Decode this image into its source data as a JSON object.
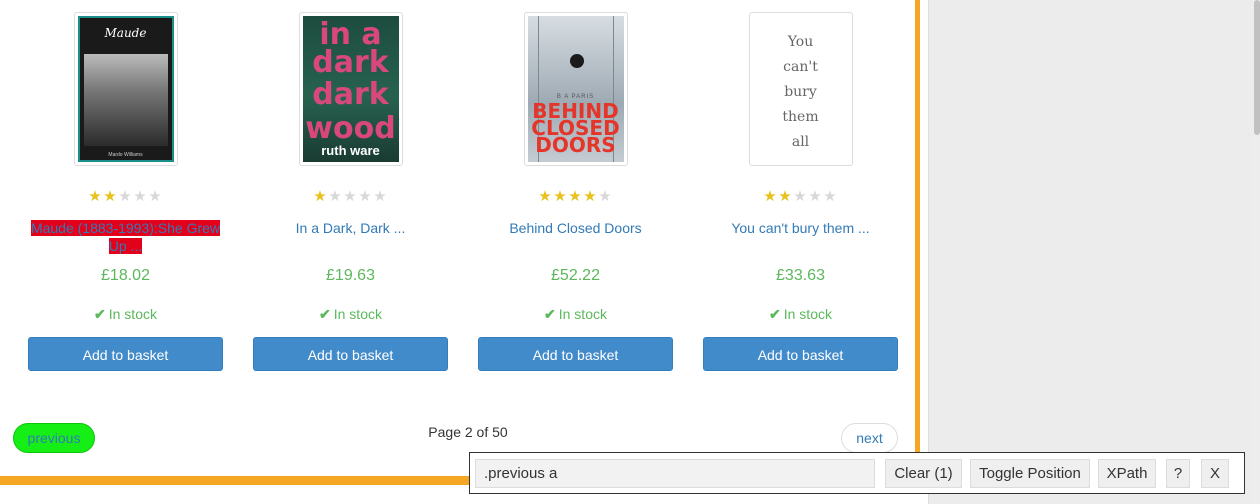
{
  "products": [
    {
      "title": "Maude (1883-1993):She Grew Up ...",
      "price": "£18.02",
      "stock": "In stock",
      "rating": 2,
      "button": "Add to basket",
      "highlighted": true,
      "cover": {
        "title": "Maude",
        "author": "Mardo Williams"
      }
    },
    {
      "title": "In a Dark, Dark ...",
      "price": "£19.63",
      "stock": "In stock",
      "rating": 1,
      "button": "Add to basket",
      "highlighted": false,
      "cover": {
        "lines": [
          "in a",
          "dark",
          "dark",
          "wood"
        ],
        "author": "ruth ware"
      }
    },
    {
      "title": "Behind Closed Doors",
      "price": "£52.22",
      "stock": "In stock",
      "rating": 4,
      "button": "Add to basket",
      "highlighted": false,
      "cover": {
        "author": "B A PARIS",
        "lines": [
          "BEHIND",
          "CLOSED",
          "DOORS"
        ]
      }
    },
    {
      "title": "You can't bury them ...",
      "price": "£33.63",
      "stock": "In stock",
      "rating": 2,
      "button": "Add to basket",
      "highlighted": false,
      "cover": {
        "lines": [
          "You",
          "can't",
          "bury",
          "them",
          "all"
        ]
      }
    }
  ],
  "pager": {
    "previous": "previous",
    "current": "Page 2 of 50",
    "next": "next"
  },
  "toolbar": {
    "selector_value": ".previous a",
    "clear": "Clear (1)",
    "toggle": "Toggle Position",
    "xpath": "XPath",
    "help": "?",
    "close": "X"
  },
  "colors": {
    "accent_orange": "#f5a623",
    "highlight_red": "#e2001a",
    "highlight_green": "#16ef16",
    "price_green": "#5cb85c",
    "button_blue": "#428bca",
    "link_blue": "#337ab7",
    "star_gold": "#e8c21c"
  },
  "icons": {
    "stock": "check-icon",
    "rating": "star-icon"
  }
}
